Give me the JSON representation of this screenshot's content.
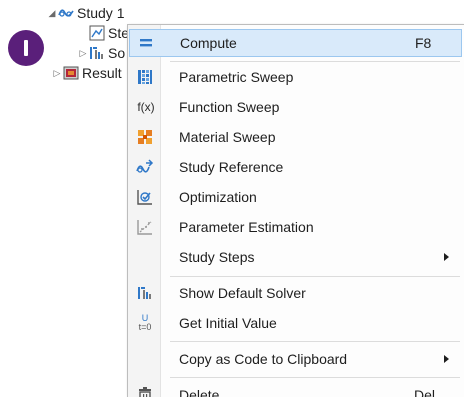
{
  "tree": {
    "study_label": "Study 1",
    "step_label": "Ste",
    "solver_label": "So",
    "results_label": "Result"
  },
  "menu": {
    "compute": {
      "label": "Compute",
      "shortcut": "F8",
      "icon": "compute-icon"
    },
    "parametric_sweep": {
      "label": "Parametric Sweep",
      "icon": "parametric-sweep-icon"
    },
    "function_sweep": {
      "label": "Function Sweep",
      "icon": "function-sweep-icon",
      "icon_text": "f(x)"
    },
    "material_sweep": {
      "label": "Material Sweep",
      "icon": "material-sweep-icon"
    },
    "study_reference": {
      "label": "Study Reference",
      "icon": "study-reference-icon"
    },
    "optimization": {
      "label": "Optimization",
      "icon": "optimization-icon"
    },
    "parameter_estimation": {
      "label": "Parameter Estimation",
      "icon": "parameter-estimation-icon"
    },
    "study_steps": {
      "label": "Study Steps",
      "has_submenu": true
    },
    "show_default_solver": {
      "label": "Show Default Solver",
      "icon": "solver-icon"
    },
    "get_initial_value": {
      "label": "Get Initial Value",
      "icon": "initial-value-icon",
      "icon_text_top": "U",
      "icon_text_bottom": "t=0"
    },
    "copy_as_code": {
      "label": "Copy as Code to Clipboard",
      "has_submenu": true
    },
    "delete": {
      "label": "Delete",
      "shortcut": "Del",
      "icon": "trash-icon"
    }
  },
  "colors": {
    "highlight_bg": "#d9eafa",
    "highlight_border": "#9cc7ef",
    "badge": "#5a1f7a",
    "icon_blue": "#2f78c8",
    "icon_orange": "#f0a030"
  }
}
